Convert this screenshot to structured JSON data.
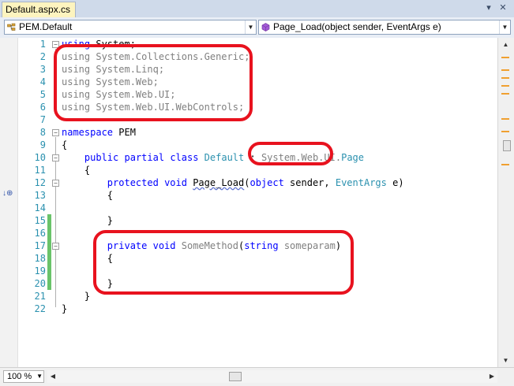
{
  "tab": {
    "title": "Default.aspx.cs",
    "controls": {
      "dropdown": "▾",
      "close": "✕"
    }
  },
  "nav": {
    "type_combo": {
      "value": "PEM.Default",
      "icon": "class-icon"
    },
    "member_combo": {
      "value": "Page_Load(object sender, EventArgs e)",
      "icon": "method-icon"
    }
  },
  "editor": {
    "line_numbers": [
      "1",
      "2",
      "3",
      "4",
      "5",
      "6",
      "7",
      "8",
      "9",
      "10",
      "11",
      "12",
      "13",
      "14",
      "15",
      "16",
      "17",
      "18",
      "19",
      "20",
      "21",
      "22"
    ],
    "lines": [
      "using System;",
      "using System.Collections.Generic;",
      "using System.Linq;",
      "using System.Web;",
      "using System.Web.UI;",
      "using System.Web.UI.WebControls;",
      "",
      "namespace PEM",
      "{",
      "public partial class Default : System.Web.UI.Page",
      "{",
      "protected void Page_Load(object sender, EventArgs e)",
      "{",
      "",
      "}",
      "",
      "private void SomeMethod(string someparam)",
      "{",
      "",
      "}",
      "}",
      "}"
    ],
    "colors": {
      "keyword": "#0000ff",
      "type": "#2b91af",
      "gray": "#808080",
      "annotation": "#e8121e",
      "change_bar": "#6ac36a"
    }
  },
  "status": {
    "zoom": "100 %"
  }
}
